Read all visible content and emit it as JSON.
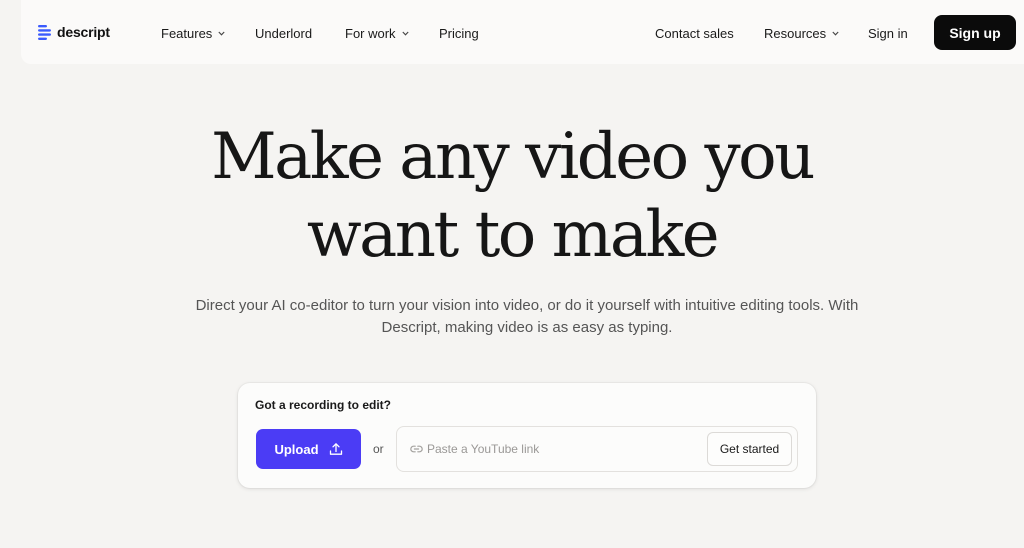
{
  "brand": {
    "name": "descript",
    "accent": "#4b3cf5",
    "logo_color": "#3b5bfd"
  },
  "nav": {
    "items": [
      {
        "label": "Features",
        "has_dropdown": true
      },
      {
        "label": "Underlord",
        "has_dropdown": false
      },
      {
        "label": "For work",
        "has_dropdown": true
      },
      {
        "label": "Pricing",
        "has_dropdown": false
      }
    ],
    "right": {
      "contact_sales": "Contact sales",
      "resources": "Resources",
      "sign_in": "Sign in",
      "sign_up": "Sign up"
    }
  },
  "hero": {
    "title_line1": "Make any video you",
    "title_line2": "want to make",
    "subtitle": "Direct your AI co-editor to turn your vision into video, or do it yourself with intuitive editing tools. With Descript, making video is as easy as typing."
  },
  "upload_card": {
    "label": "Got a recording to edit?",
    "upload_label": "Upload",
    "upload_icon": "upload-icon",
    "or_text": "or",
    "link_icon": "link-icon",
    "link_placeholder": "Paste a YouTube link",
    "link_value": "",
    "get_started_label": "Get started"
  }
}
